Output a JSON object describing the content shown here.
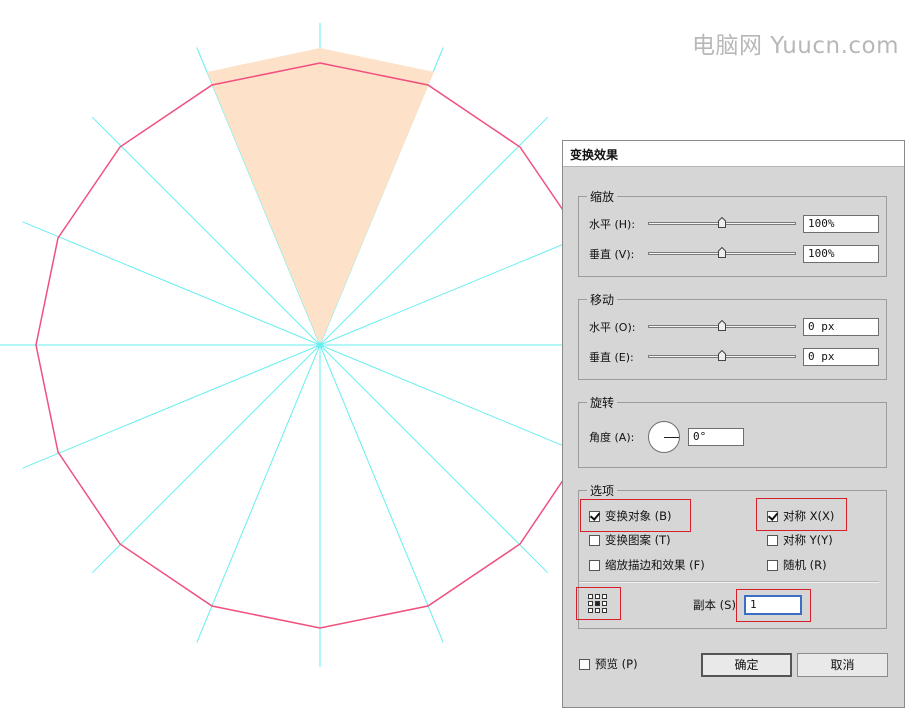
{
  "watermark": "电脑网 Yuucn.com",
  "colors": {
    "polygon": "#f0507e",
    "guides": "#66eef0",
    "highlight": "#fde0c6",
    "annotation": "#d61f28"
  },
  "dialog": {
    "title": "变换效果",
    "scale": {
      "label": "缩放",
      "horizontal": {
        "label": "水平 (H):",
        "value": "100%",
        "slider_fraction": 0.5
      },
      "vertical": {
        "label": "垂直 (V):",
        "value": "100%",
        "slider_fraction": 0.5
      }
    },
    "move": {
      "label": "移动",
      "horizontal": {
        "label": "水平 (O):",
        "value": "0 px",
        "slider_fraction": 0.5
      },
      "vertical": {
        "label": "垂直 (E):",
        "value": "0 px",
        "slider_fraction": 0.5
      }
    },
    "rotate": {
      "label": "旋转",
      "angle": {
        "label": "角度 (A):",
        "value": "0°"
      }
    },
    "options": {
      "label": "选项",
      "transform_objects": {
        "label": "变换对象 (B)",
        "checked": true
      },
      "transform_patterns": {
        "label": "变换图案 (T)",
        "checked": false
      },
      "scale_strokes": {
        "label": "缩放描边和效果 (F)",
        "checked": false
      },
      "reflect_x": {
        "label": "对称 X(X)",
        "checked": true
      },
      "reflect_y": {
        "label": "对称 Y(Y)",
        "checked": false
      },
      "random": {
        "label": "随机 (R)",
        "checked": false
      },
      "copies": {
        "label": "副本 (S)",
        "value": "1"
      }
    },
    "preview": {
      "label": "预览 (P)",
      "checked": false
    },
    "ok_label": "确定",
    "cancel_label": "取消"
  }
}
